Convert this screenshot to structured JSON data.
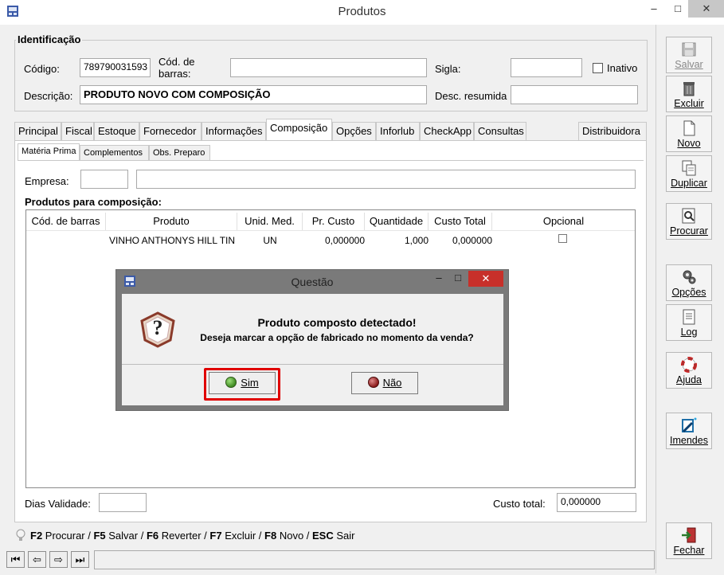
{
  "window": {
    "title": "Produtos",
    "minimize": "–",
    "maximize": "□",
    "close": "✕"
  },
  "identificacao": {
    "group_title": "Identificação",
    "codigo_label": "Código:",
    "codigo_value": "789790031593",
    "cod_barras_label": "Cód. de barras:",
    "cod_barras_value": "",
    "sigla_label": "Sigla:",
    "sigla_value": "",
    "inativo_label": "Inativo",
    "descricao_label": "Descrição:",
    "descricao_value": "PRODUTO NOVO COM COMPOSIÇÃO",
    "desc_resumida_label": "Desc. resumida",
    "desc_resumida_value": ""
  },
  "tabs": [
    "Principal",
    "Fiscal",
    "Estoque",
    "Fornecedor",
    "Informações",
    "Composição",
    "Opções",
    "Inforlub",
    "CheckApp",
    "Consultas"
  ],
  "tab_right": "Distribuidora",
  "active_tab": "Composição",
  "subtabs": [
    "Matéria Prima",
    "Complementos",
    "Obs. Preparo"
  ],
  "composicao": {
    "empresa_label": "Empresa:",
    "empresa_code": "",
    "empresa_name": "",
    "section_title": "Produtos para composição:",
    "columns": [
      "Cód. de barras",
      "Produto",
      "Unid. Med.",
      "Pr. Custo",
      "Quantidade",
      "Custo Total",
      "Opcional"
    ],
    "rows": [
      {
        "cod_barras": "",
        "produto": "VINHO ANTHONYS HILL TIN",
        "unid": "UN",
        "pr_custo": "0,000000",
        "quantidade": "1,000",
        "custo_total": "0,000000",
        "opcional": false
      }
    ],
    "dias_validade_label": "Dias Validade:",
    "dias_validade_value": "",
    "custo_total_label": "Custo total:",
    "custo_total_value": "0,000000"
  },
  "shortcuts": [
    {
      "key": "F2",
      "label": " Procurar / "
    },
    {
      "key": "F5",
      "label": " Salvar / "
    },
    {
      "key": "F6",
      "label": " Reverter / "
    },
    {
      "key": "F7",
      "label": " Excluir / "
    },
    {
      "key": "F8",
      "label": " Novo / "
    },
    {
      "key": "ESC",
      "label": " Sair"
    }
  ],
  "sidebar": {
    "salvar": "Salvar",
    "excluir": "Excluir",
    "novo": "Novo",
    "duplicar": "Duplicar",
    "procurar": "Procurar",
    "opcoes": "Opções",
    "log": "Log",
    "ajuda": "Ajuda",
    "imendes": "Imendes",
    "fechar": "Fechar"
  },
  "nav": [
    "⏮",
    "⇦",
    "⇨",
    "⏭"
  ],
  "dialog": {
    "title": "Questão",
    "heading": "Produto composto detectado!",
    "message": "Deseja marcar a opção de fabricado no momento da venda?",
    "yes": "Sim",
    "no": "Não",
    "question_mark": "?"
  },
  "colors": {
    "highlight": "#e00000",
    "yes_icon": "#4a9a2a",
    "no_icon": "#a02020",
    "dialog_frame": "#7a7a7a"
  }
}
